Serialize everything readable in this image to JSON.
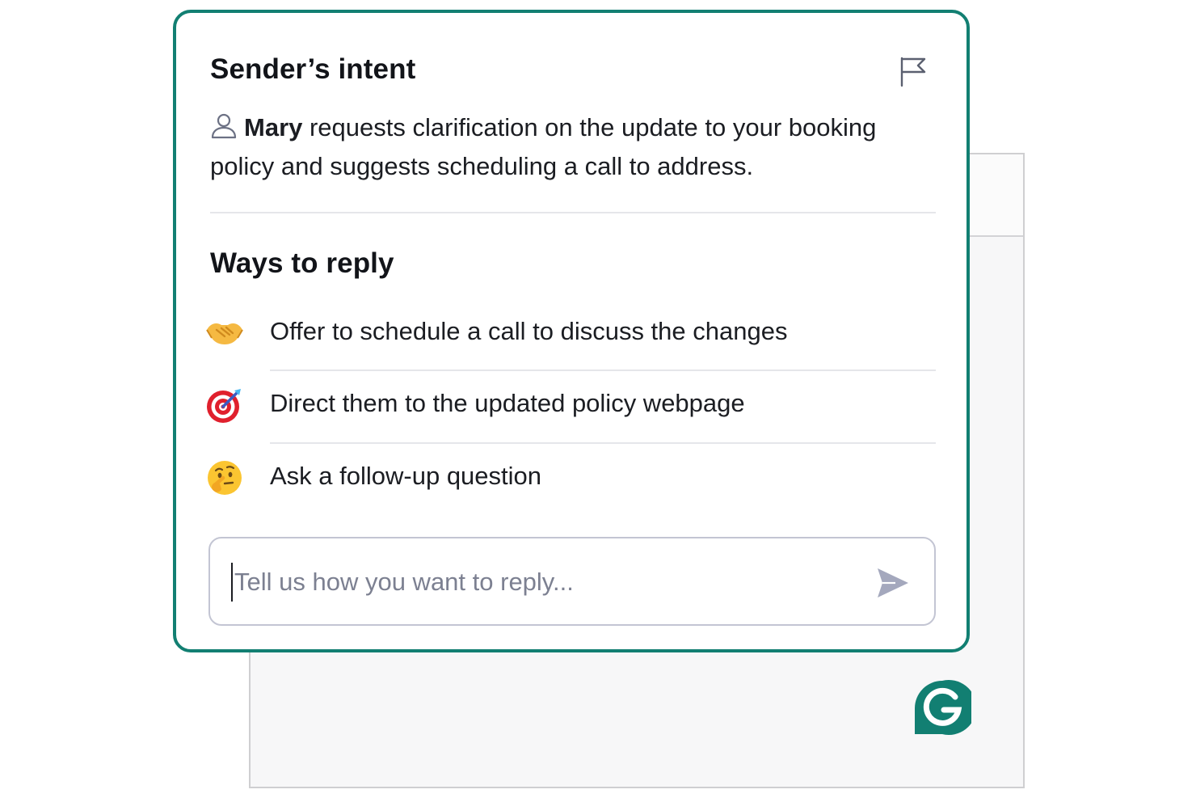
{
  "intent": {
    "title": "Sender’s intent",
    "sender_name": "Mary",
    "summary": " requests clarification on the update to your booking policy and suggests scheduling a call to address."
  },
  "ways": {
    "title": "Ways to reply",
    "options": [
      {
        "label": "Offer to schedule a call to discuss the changes",
        "icon": "handshake-icon"
      },
      {
        "label": "Direct them to the updated policy webpage",
        "icon": "target-icon"
      },
      {
        "label": "Ask a follow-up question",
        "icon": "thinking-face-icon"
      }
    ]
  },
  "reply": {
    "placeholder": "Tell us how you want to reply..."
  },
  "colors": {
    "accent": "#127f72",
    "text": "#1b1d22",
    "muted": "#7c8091"
  }
}
